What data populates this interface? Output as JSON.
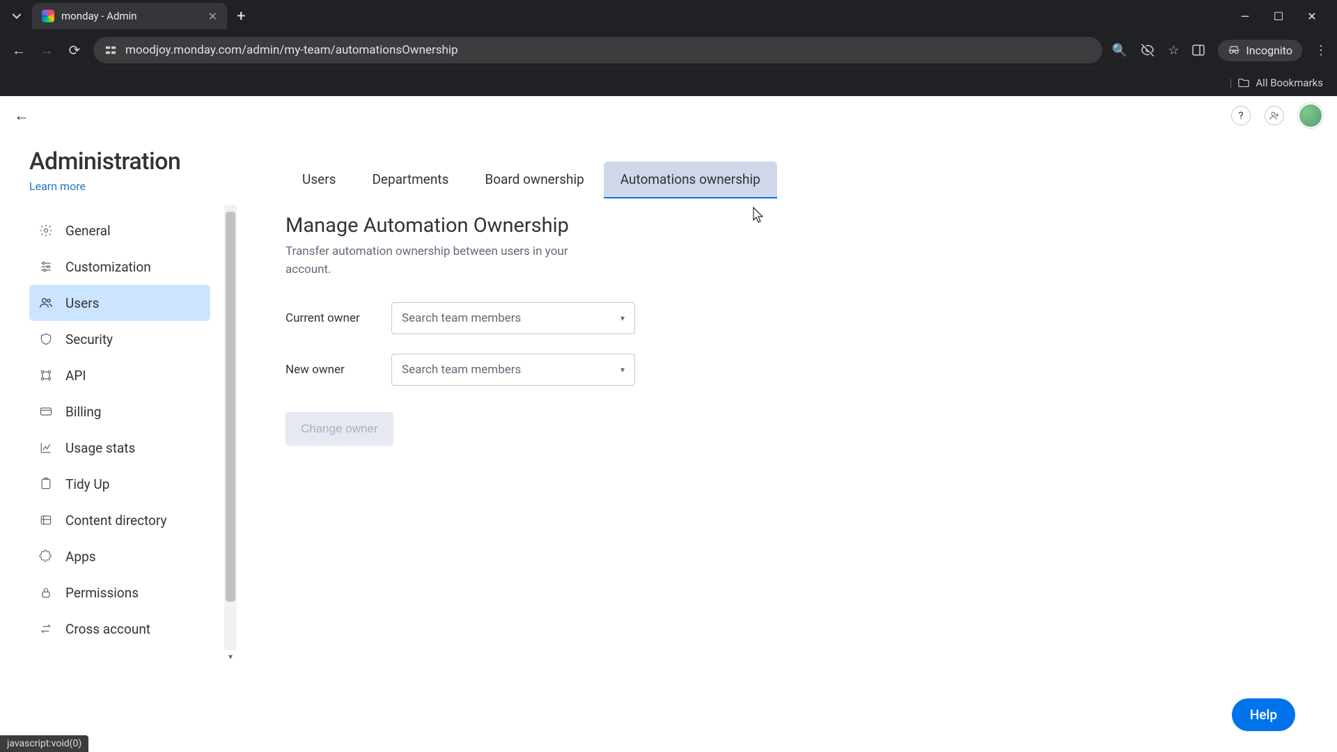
{
  "browser": {
    "tab_title": "monday - Admin",
    "url": "moodjoy.monday.com/admin/my-team/automationsOwnership",
    "incognito_label": "Incognito",
    "bookmarks_label": "All Bookmarks",
    "status_text": "javascript:void(0)"
  },
  "app_header": {
    "help_tooltip": "?",
    "refresh_tooltip": "↻"
  },
  "sidebar": {
    "title": "Administration",
    "learn_more": "Learn more",
    "items": [
      {
        "label": "General",
        "icon": "gear"
      },
      {
        "label": "Customization",
        "icon": "sliders"
      },
      {
        "label": "Users",
        "icon": "users",
        "active": true
      },
      {
        "label": "Security",
        "icon": "shield"
      },
      {
        "label": "API",
        "icon": "api"
      },
      {
        "label": "Billing",
        "icon": "card"
      },
      {
        "label": "Usage stats",
        "icon": "chart"
      },
      {
        "label": "Tidy Up",
        "icon": "broom"
      },
      {
        "label": "Content directory",
        "icon": "folder"
      },
      {
        "label": "Apps",
        "icon": "puzzle"
      },
      {
        "label": "Permissions",
        "icon": "lock"
      },
      {
        "label": "Cross account",
        "icon": "switch"
      }
    ]
  },
  "main": {
    "tabs": [
      {
        "label": "Users"
      },
      {
        "label": "Departments"
      },
      {
        "label": "Board ownership"
      },
      {
        "label": "Automations ownership",
        "active": true
      }
    ],
    "title": "Manage Automation Ownership",
    "description": "Transfer automation ownership between users in your account.",
    "current_owner_label": "Current owner",
    "new_owner_label": "New owner",
    "select_placeholder": "Search team members",
    "change_button": "Change owner"
  },
  "help_button": "Help"
}
